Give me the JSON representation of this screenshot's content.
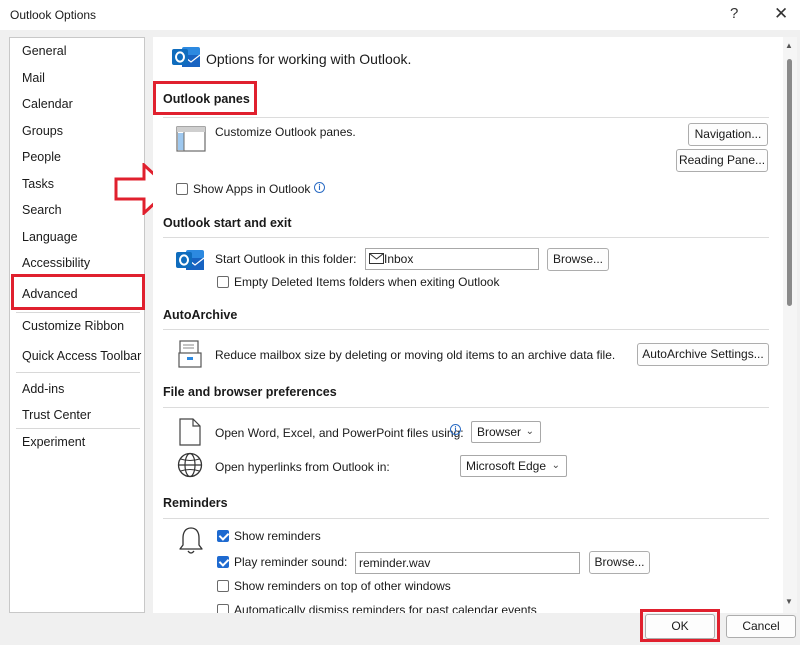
{
  "window": {
    "title": "Outlook Options",
    "help_glyph": "?",
    "close_glyph": "✕"
  },
  "sidebar": {
    "items": [
      {
        "label": "General"
      },
      {
        "label": "Mail"
      },
      {
        "label": "Calendar"
      },
      {
        "label": "Groups"
      },
      {
        "label": "People"
      },
      {
        "label": "Tasks"
      },
      {
        "label": "Search"
      },
      {
        "label": "Language"
      },
      {
        "label": "Accessibility"
      },
      {
        "label": "Advanced",
        "selected": true
      },
      {
        "label": "Customize Ribbon"
      },
      {
        "label": "Quick Access Toolbar"
      },
      {
        "label": "Add-ins"
      },
      {
        "label": "Trust Center"
      },
      {
        "label": "Experiment"
      }
    ]
  },
  "header": {
    "text": "Options for working with Outlook."
  },
  "outlook_panes": {
    "title": "Outlook panes",
    "description": "Customize Outlook panes.",
    "navigation_button": "Navigation...",
    "reading_pane_button": "Reading Pane...",
    "show_apps_label": "Show Apps in Outlook",
    "show_apps_checked": false
  },
  "start_exit": {
    "title": "Outlook start and exit",
    "start_folder_label": "Start Outlook in this folder:",
    "start_folder_value": "Inbox",
    "browse_button": "Browse...",
    "empty_deleted_label": "Empty Deleted Items folders when exiting Outlook",
    "empty_deleted_checked": false
  },
  "autoarchive": {
    "title": "AutoArchive",
    "description": "Reduce mailbox size by deleting or moving old items to an archive data file.",
    "settings_button": "AutoArchive Settings..."
  },
  "file_browser": {
    "title": "File and browser preferences",
    "open_files_label": "Open Word, Excel, and PowerPoint files using:",
    "open_files_value": "Browser",
    "open_links_label": "Open hyperlinks from Outlook in:",
    "open_links_value": "Microsoft Edge"
  },
  "reminders": {
    "title": "Reminders",
    "show_reminders_label": "Show reminders",
    "show_reminders_checked": true,
    "play_sound_label": "Play reminder sound:",
    "play_sound_checked": true,
    "sound_file": "reminder.wav",
    "browse_button": "Browse...",
    "on_top_label": "Show reminders on top of other windows",
    "on_top_checked": false,
    "auto_dismiss_label": "Automatically dismiss reminders for past calendar events",
    "auto_dismiss_checked": false
  },
  "footer": {
    "ok_button": "OK",
    "cancel_button": "Cancel"
  },
  "colors": {
    "highlight_red": "#e0202e",
    "outlook_blue": "#0f6cbd",
    "checkbox_blue": "#1e6ad0"
  }
}
